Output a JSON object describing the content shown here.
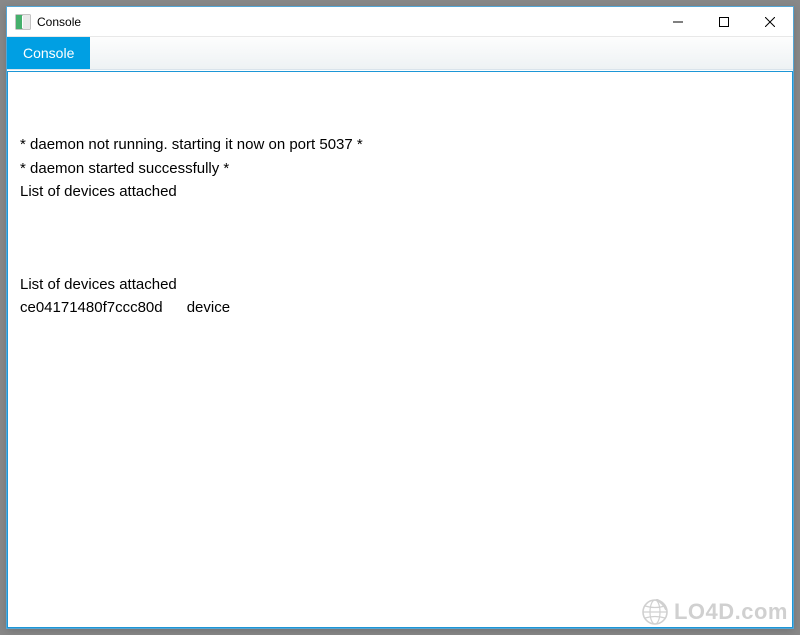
{
  "window": {
    "title": "Console"
  },
  "tabs": {
    "active": {
      "label": "Console"
    }
  },
  "console": {
    "lines": [
      "",
      "* daemon not running. starting it now on port 5037 *",
      "* daemon started successfully *",
      "List of devices attached ",
      "",
      "",
      "",
      "List of devices attached ",
      "ce04171480f7ccc80d\tdevice",
      ""
    ]
  },
  "watermark": {
    "text": "LO4D.com"
  }
}
